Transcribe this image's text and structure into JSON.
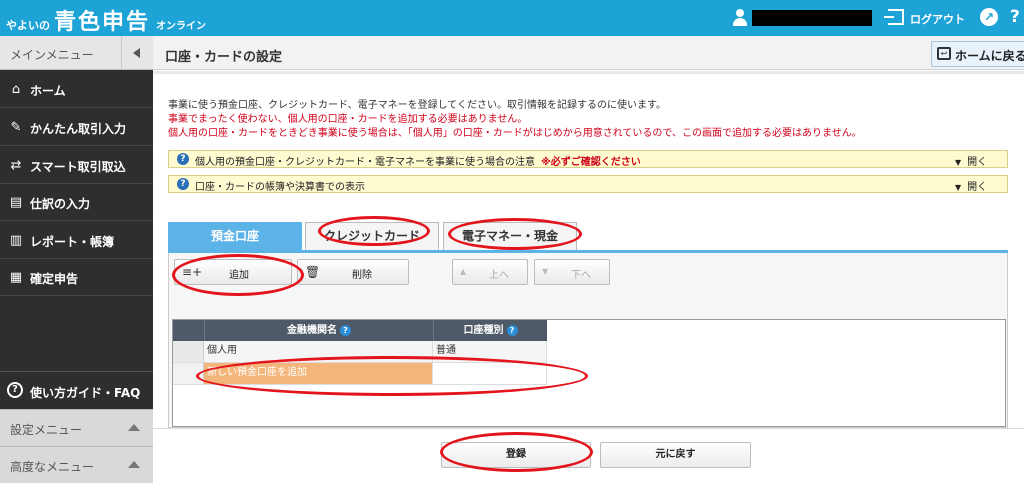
{
  "header": {
    "brand_prefix": "やよいの",
    "brand_main": "青色申告",
    "brand_suffix": "オンライン",
    "username": "",
    "logout_label": "ログアウト",
    "link_icon_glyph": "↗",
    "help_icon_glyph": "?"
  },
  "sidebar": {
    "menu_title": "メインメニュー",
    "items": [
      {
        "label": "ホーム",
        "icon": "home-icon",
        "glyph": "⌂"
      },
      {
        "label": "かんたん取引入力",
        "icon": "pencil-icon",
        "glyph": "✎"
      },
      {
        "label": "スマート取引取込",
        "icon": "import-icon",
        "glyph": "⇄"
      },
      {
        "label": "仕訳の入力",
        "icon": "journal-icon",
        "glyph": "▤"
      },
      {
        "label": "レポート・帳簿",
        "icon": "chart-icon",
        "glyph": "▥"
      },
      {
        "label": "確定申告",
        "icon": "calculator-icon",
        "glyph": "▦"
      }
    ],
    "guide_label": "使い方ガイド・FAQ",
    "guide_glyph": "?",
    "settings_menu": "設定メニュー",
    "advanced_menu": "高度なメニュー"
  },
  "page": {
    "title": "口座・カードの設定",
    "home_button": "ホームに戻る",
    "home_icon_glyph": "↩"
  },
  "intro": {
    "line1": "事業に使う預金口座、クレジットカード、電子マネーを登録してください。取引情報を記録するのに使います。",
    "line2": "事業でまったく使わない、個人用の口座・カードを追加する必要はありません。",
    "line3": "個人用の口座・カードをときどき事業に使う場合は、「個人用」の口座・カードがはじめから用意されているので、この画面で追加する必要はありません。"
  },
  "notices": [
    {
      "text": "個人用の預金口座・クレジットカード・電子マネーを事業に使う場合の注意",
      "warning": "※必ずご確認ください",
      "open_label": "開く",
      "glyph": "?"
    },
    {
      "text": "口座・カードの帳簿や決算書での表示",
      "warning": "",
      "open_label": "開く",
      "glyph": "?"
    }
  ],
  "tabs": [
    {
      "label": "預金口座",
      "active": true
    },
    {
      "label": "クレジットカード",
      "active": false
    },
    {
      "label": "電子マネー・現金",
      "active": false
    }
  ],
  "toolbar": {
    "add_label": "追加",
    "add_glyph": "≡+",
    "delete_label": "削除",
    "delete_glyph": "🗑",
    "up_label": "上へ",
    "up_glyph": "▲",
    "down_label": "下へ",
    "down_glyph": "▼"
  },
  "table": {
    "columns": [
      "金融機関名",
      "口座種別"
    ],
    "help_glyph": "?",
    "rows": [
      {
        "name": "個人用",
        "type": "普通"
      },
      {
        "name": "新しい預金口座を追加",
        "type": ""
      }
    ]
  },
  "footer": {
    "register_label": "登録",
    "back_label": "元に戻す"
  },
  "colors": {
    "header_bg": "#1ea3d6",
    "sidebar_bg": "#2e2e2e",
    "active_tab": "#5cb3e8",
    "new_row_highlight": "#f3b57a",
    "annotation_red": "#e3141c",
    "warning_text": "#d0021b"
  }
}
